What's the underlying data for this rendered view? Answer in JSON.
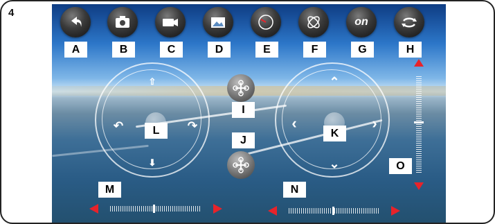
{
  "figure_number": "4",
  "top_buttons": [
    {
      "label": "A",
      "icon": "return-arrow-icon"
    },
    {
      "label": "B",
      "icon": "camera-icon"
    },
    {
      "label": "C",
      "icon": "video-camera-icon"
    },
    {
      "label": "D",
      "icon": "gallery-icon"
    },
    {
      "label": "E",
      "icon": "gauge-icon"
    },
    {
      "label": "F",
      "icon": "gyro-icon"
    },
    {
      "label": "G",
      "icon": "on-icon",
      "text": "on"
    },
    {
      "label": "H",
      "icon": "rotate-icon"
    }
  ],
  "left_joystick": {
    "label": "L"
  },
  "right_joystick": {
    "label": "K"
  },
  "drone_buttons": [
    {
      "label": "I",
      "icon": "drone-up-icon"
    },
    {
      "label": "J",
      "icon": "drone-down-icon"
    }
  ],
  "sliders": {
    "left_trim": {
      "label": "M"
    },
    "right_trim": {
      "label": "N"
    },
    "vertical_trim": {
      "label": "O"
    }
  },
  "colors": {
    "accent_red": "#e8232a",
    "frame": "#222222"
  }
}
